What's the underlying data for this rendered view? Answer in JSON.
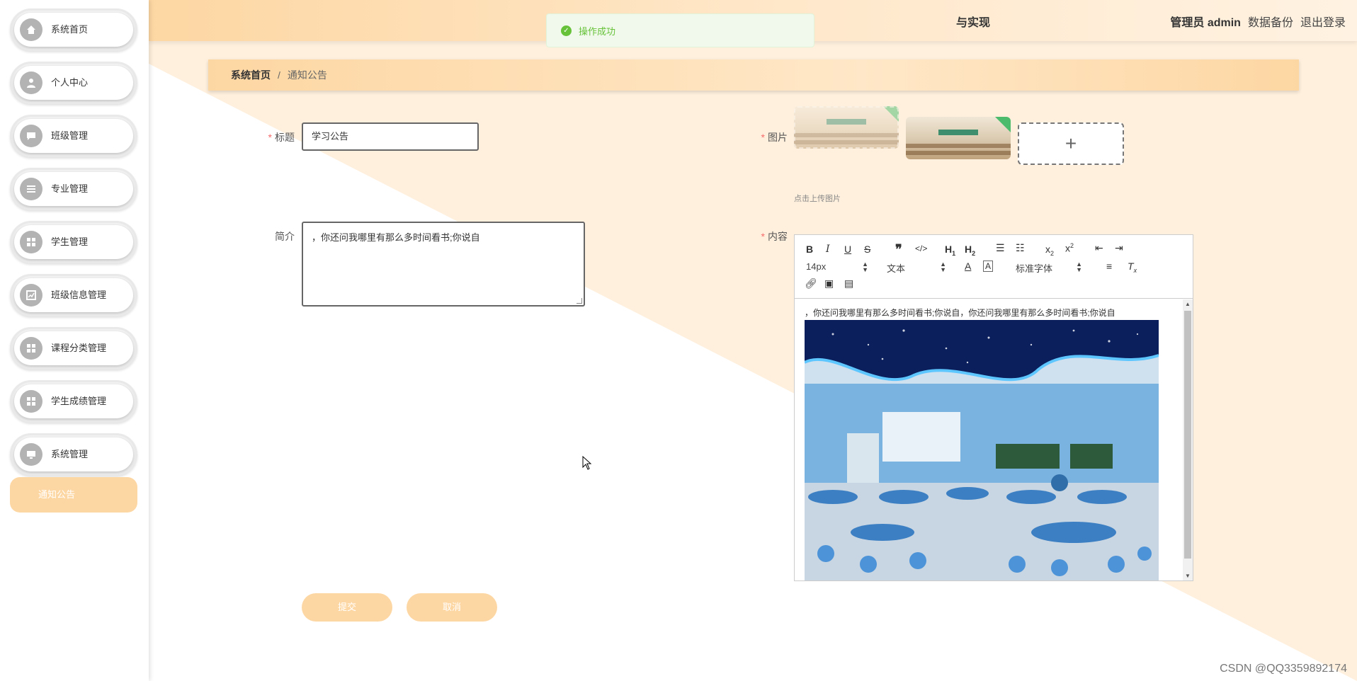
{
  "header": {
    "title_fragment": "与实现",
    "admin": "管理员 admin",
    "backup": "数据备份",
    "logout": "退出登录"
  },
  "toast": {
    "message": "操作成功"
  },
  "sidebar": {
    "items": [
      {
        "label": "系统首页",
        "icon": "home-icon"
      },
      {
        "label": "个人中心",
        "icon": "user-icon"
      },
      {
        "label": "班级管理",
        "icon": "chat-icon"
      },
      {
        "label": "专业管理",
        "icon": "list-icon"
      },
      {
        "label": "学生管理",
        "icon": "grid-icon"
      },
      {
        "label": "班级信息管理",
        "icon": "chart-icon"
      },
      {
        "label": "课程分类管理",
        "icon": "grid-icon"
      },
      {
        "label": "学生成绩管理",
        "icon": "grid-icon"
      },
      {
        "label": "系统管理",
        "icon": "monitor-icon"
      }
    ],
    "sub_item": "通知公告"
  },
  "breadcrumb": {
    "home": "系统首页",
    "separator": "/",
    "current": "通知公告"
  },
  "form": {
    "title_label": "标题",
    "title_value": "学习公告",
    "summary_label": "简介",
    "summary_value": "，你还问我哪里有那么多时间看书;你说自",
    "image_label": "图片",
    "upload_tip": "点击上传图片",
    "content_label": "内容",
    "submit": "提交",
    "cancel": "取消"
  },
  "editor": {
    "font_size": "14px",
    "heading": "文本",
    "font_family": "标准字体",
    "content_text": "，你还问我哪里有那么多时间看书;你说自，你还问我哪里有那么多时间看书;你说自"
  },
  "colors": {
    "accent": "#fdd7a3",
    "success": "#67c23a",
    "required": "#f56c6c"
  },
  "watermark": "CSDN @QQ3359892174"
}
